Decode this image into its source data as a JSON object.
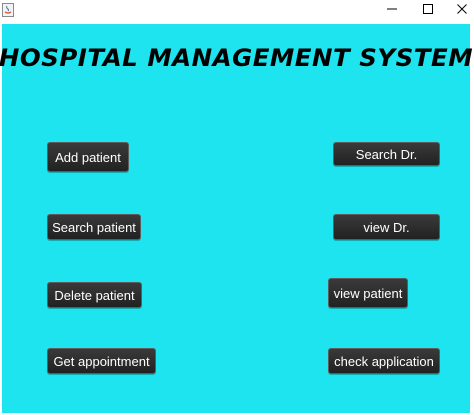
{
  "window": {
    "controls": {
      "minimize_icon": "minimize-icon",
      "maximize_icon": "maximize-icon",
      "close_icon": "close-icon"
    }
  },
  "colors": {
    "background": "#1de4ee",
    "button": "#2a2a2a",
    "button_text": "#ffffff"
  },
  "header": {
    "title": "HOSPITAL MANAGEMENT SYSTEM"
  },
  "buttons": {
    "add_patient": "Add patient",
    "search_patient": "Search patient",
    "delete_patient": "Delete patient",
    "get_appointment": "Get appointment",
    "search_dr": "Search Dr.",
    "view_dr": "view Dr.",
    "view_patient": "view patient",
    "check_application": "check application"
  }
}
